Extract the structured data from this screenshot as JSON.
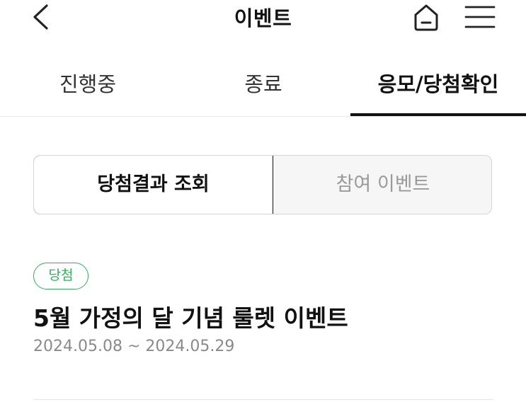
{
  "header": {
    "title": "이벤트",
    "back_icon": "chevron-left-icon",
    "home_icon": "home-icon",
    "menu_icon": "hamburger-menu-icon"
  },
  "tabs": [
    {
      "label": "진행중",
      "active": false
    },
    {
      "label": "종료",
      "active": false
    },
    {
      "label": "응모/당첨확인",
      "active": true
    }
  ],
  "segment": {
    "options": [
      {
        "label": "당첨결과 조회",
        "active": true
      },
      {
        "label": "참여 이벤트",
        "active": false
      }
    ]
  },
  "events": [
    {
      "badge": "당첨",
      "title": "5월 가정의 달 기념 룰렛 이벤트",
      "dates": "2024.05.08 ~ 2024.05.29"
    }
  ],
  "colors": {
    "accent_green": "#2fb25b",
    "text_primary": "#111111",
    "text_muted": "#8a8a8a"
  }
}
